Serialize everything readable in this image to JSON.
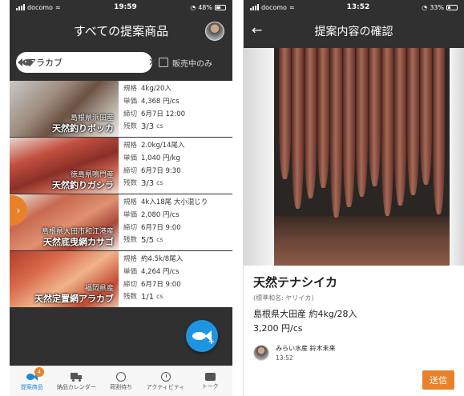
{
  "left": {
    "status": {
      "carrier": "docomo",
      "time": "19:59",
      "battery": "48%",
      "battery_level": 0.48
    },
    "header": {
      "title": "すべての提案商品"
    },
    "search": {
      "value": "アラカブ",
      "clear": "✕"
    },
    "filter": {
      "label": "販売中のみ"
    },
    "spec_labels": {
      "size": "規格",
      "price": "単価",
      "deadline": "締切",
      "stock": "残数",
      "stock_unit": "cs"
    },
    "listings": [
      {
        "origin": "島根県浜田産",
        "name": "天然釣りボッカ",
        "size": "4kg/20入",
        "price": "4,368 円/cs",
        "deadline": "6月7日 12:00",
        "stock": "3/3"
      },
      {
        "origin": "徳島県鳴門産",
        "name": "天然釣りガシラ",
        "size": "2.0kg/14尾入",
        "price": "1,040 円/kg",
        "deadline": "6月7日 9:30",
        "stock": "3/3"
      },
      {
        "origin": "島根県大田市和江港産",
        "name": "天然底曳網カサゴ",
        "size": "4k入18尾 大小混じり",
        "price": "2,080 円/cs",
        "deadline": "6月7日 9:00",
        "stock": "5/5"
      },
      {
        "origin": "福岡県産",
        "name": "天然定置網アラカブ",
        "size": "約4.5k/8尾入",
        "price": "4,264 円/cs",
        "deadline": "6月7日 9:00",
        "stock": "1/1"
      }
    ],
    "tabs": [
      {
        "label": "提案商品",
        "badge": "4"
      },
      {
        "label": "納品カレンダー"
      },
      {
        "label": "荷割待ち"
      },
      {
        "label": "アクティビティ"
      },
      {
        "label": "トーク"
      }
    ],
    "icons": {
      "side_tab": "chevron-right-icon",
      "fab": "add-fish-icon"
    }
  },
  "right": {
    "status": {
      "carrier": "docomo",
      "time": "13:52",
      "battery": "33%",
      "battery_level": 0.33
    },
    "header": {
      "title": "提案内容の確認",
      "back": "←"
    },
    "product": {
      "name": "天然テナシイカ",
      "standard_name": "(標準和名: ヤリイカ)",
      "origin_size": "島根県大田産 約4kg/28入",
      "price": "3,200 円/cs"
    },
    "seller": {
      "name": "みらい水産 鈴木未来",
      "time": "13:52"
    },
    "send_label": "送信"
  },
  "colors": {
    "accent_orange": "#e8812a",
    "accent_blue": "#1e95e0",
    "header_dark": "#303030"
  }
}
